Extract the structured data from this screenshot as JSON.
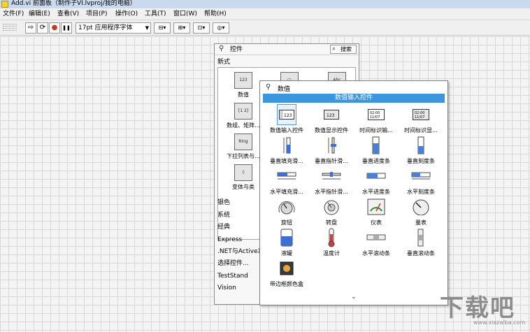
{
  "window": {
    "title": "Add.vi 前面板（制作子VI.lvproj/我的电脑）"
  },
  "menu": [
    "文件(F)",
    "编辑(E)",
    "查看(V)",
    "项目(P)",
    "操作(O)",
    "工具(T)",
    "窗口(W)",
    "帮助(H)"
  ],
  "toolbar": {
    "run": "⇨",
    "run_continuous": "⟳",
    "abort": "●",
    "pause": "❚❚",
    "font": "17pt 应用程序字体",
    "align": "⊟▾",
    "distribute": "⊞▾",
    "resize": "⊡▾",
    "reorder": "◎▾"
  },
  "palette": {
    "title": "控件",
    "search": "搜索",
    "subtitle": "新式",
    "categories": [
      {
        "icon": "123",
        "label": "数值"
      },
      {
        "icon": "[1 2]",
        "label": "数组、矩阵..."
      },
      {
        "icon": "Ring",
        "label": "下拉列表与..."
      },
      {
        "icon": "◊",
        "label": "变体与类"
      },
      {
        "icon": "Abc",
        "label": ""
      },
      {
        "icon": "▢",
        "label": ""
      }
    ],
    "list": [
      "银色",
      "系统",
      "经典",
      "Express",
      ".NET与ActiveX",
      "选择控件...",
      "TestStand",
      "Vision"
    ]
  },
  "numeric": {
    "title": "数值",
    "band": "数值输入控件",
    "more": "⌄",
    "items": [
      "数值输入控件",
      "数值显示控件",
      "时间标识输...",
      "时间标识显...",
      "垂直填充滑...",
      "垂直指针滑...",
      "垂直进度条",
      "垂直刻度条",
      "水平填充滑...",
      "水平指针滑...",
      "水平进度条",
      "水平刻度条",
      "旋钮",
      "转盘",
      "仪表",
      "量表",
      "液罐",
      "温度计",
      "水平滚动条",
      "垂直滚动条",
      "带边框颜色盒"
    ]
  },
  "watermark": {
    "big": "下载吧",
    "small": "www.xiazaiba.com"
  },
  "colors": {
    "highlight": "#3c96dd",
    "canvas_grid": "#d8d8d8"
  }
}
